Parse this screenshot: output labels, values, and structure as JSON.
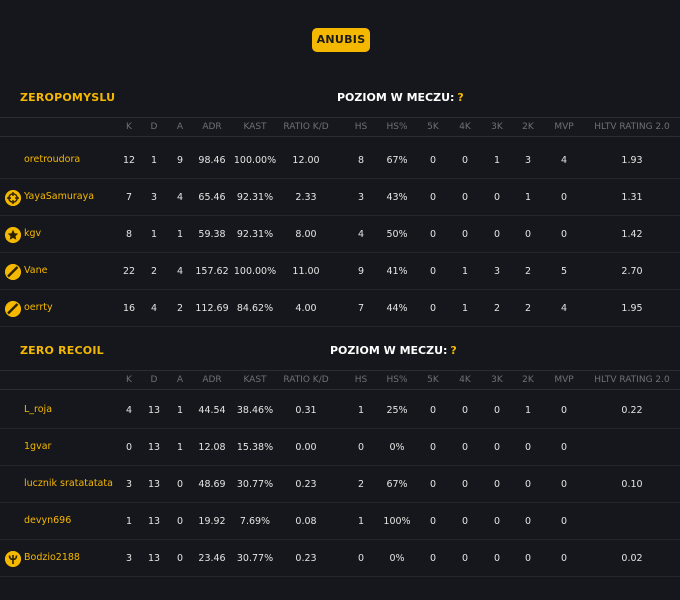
{
  "map": "ANUBIS",
  "columns": [
    "K",
    "D",
    "A",
    "ADR",
    "KAST",
    "RATIO K/D",
    "HS",
    "HS%",
    "5K",
    "4K",
    "3K",
    "2K",
    "MVP",
    "HLTV RATING 2.0"
  ],
  "level_label": "POZIOM W MECZU:",
  "level_value": "?",
  "teams": [
    {
      "name": "ZEROPOMYSLU",
      "players": [
        {
          "name": "oretroudora",
          "avatar": "",
          "stats": [
            "12",
            "1",
            "9",
            "98.46",
            "100.00%",
            "12.00",
            "8",
            "67%",
            "0",
            "0",
            "1",
            "3",
            "4",
            "1.93"
          ]
        },
        {
          "name": "YayaSamuraya",
          "avatar": "crosshair-icon",
          "stats": [
            "7",
            "3",
            "4",
            "65.46",
            "92.31%",
            "2.33",
            "3",
            "43%",
            "0",
            "0",
            "0",
            "1",
            "0",
            "1.31"
          ]
        },
        {
          "name": "kgv",
          "avatar": "star-icon",
          "stats": [
            "8",
            "1",
            "1",
            "59.38",
            "92.31%",
            "8.00",
            "4",
            "50%",
            "0",
            "0",
            "0",
            "0",
            "0",
            "1.42"
          ]
        },
        {
          "name": "Vane",
          "avatar": "slash-icon",
          "stats": [
            "22",
            "2",
            "4",
            "157.62",
            "100.00%",
            "11.00",
            "9",
            "41%",
            "0",
            "1",
            "3",
            "2",
            "5",
            "2.70"
          ]
        },
        {
          "name": "oerrty",
          "avatar": "slash-icon",
          "stats": [
            "16",
            "4",
            "2",
            "112.69",
            "84.62%",
            "4.00",
            "7",
            "44%",
            "0",
            "1",
            "2",
            "2",
            "4",
            "1.95"
          ]
        }
      ]
    },
    {
      "name": "ZERO RECOIL",
      "players": [
        {
          "name": "L_roja",
          "avatar": "",
          "stats": [
            "4",
            "13",
            "1",
            "44.54",
            "38.46%",
            "0.31",
            "1",
            "25%",
            "0",
            "0",
            "0",
            "1",
            "0",
            "0.22"
          ]
        },
        {
          "name": "1gvar",
          "avatar": "",
          "stats": [
            "0",
            "13",
            "1",
            "12.08",
            "15.38%",
            "0.00",
            "0",
            "0%",
            "0",
            "0",
            "0",
            "0",
            "0",
            ""
          ]
        },
        {
          "name": "lucznik sratatatata",
          "avatar": "",
          "stats": [
            "3",
            "13",
            "0",
            "48.69",
            "30.77%",
            "0.23",
            "2",
            "67%",
            "0",
            "0",
            "0",
            "0",
            "0",
            "0.10"
          ]
        },
        {
          "name": "devyn696",
          "avatar": "",
          "stats": [
            "1",
            "13",
            "0",
            "19.92",
            "7.69%",
            "0.08",
            "1",
            "100%",
            "0",
            "0",
            "0",
            "0",
            "0",
            ""
          ]
        },
        {
          "name": "Bodzio2188",
          "avatar": "trident-icon",
          "stats": [
            "3",
            "13",
            "0",
            "23.46",
            "30.77%",
            "0.23",
            "0",
            "0%",
            "0",
            "0",
            "0",
            "0",
            "0",
            "0.02"
          ]
        }
      ]
    }
  ]
}
